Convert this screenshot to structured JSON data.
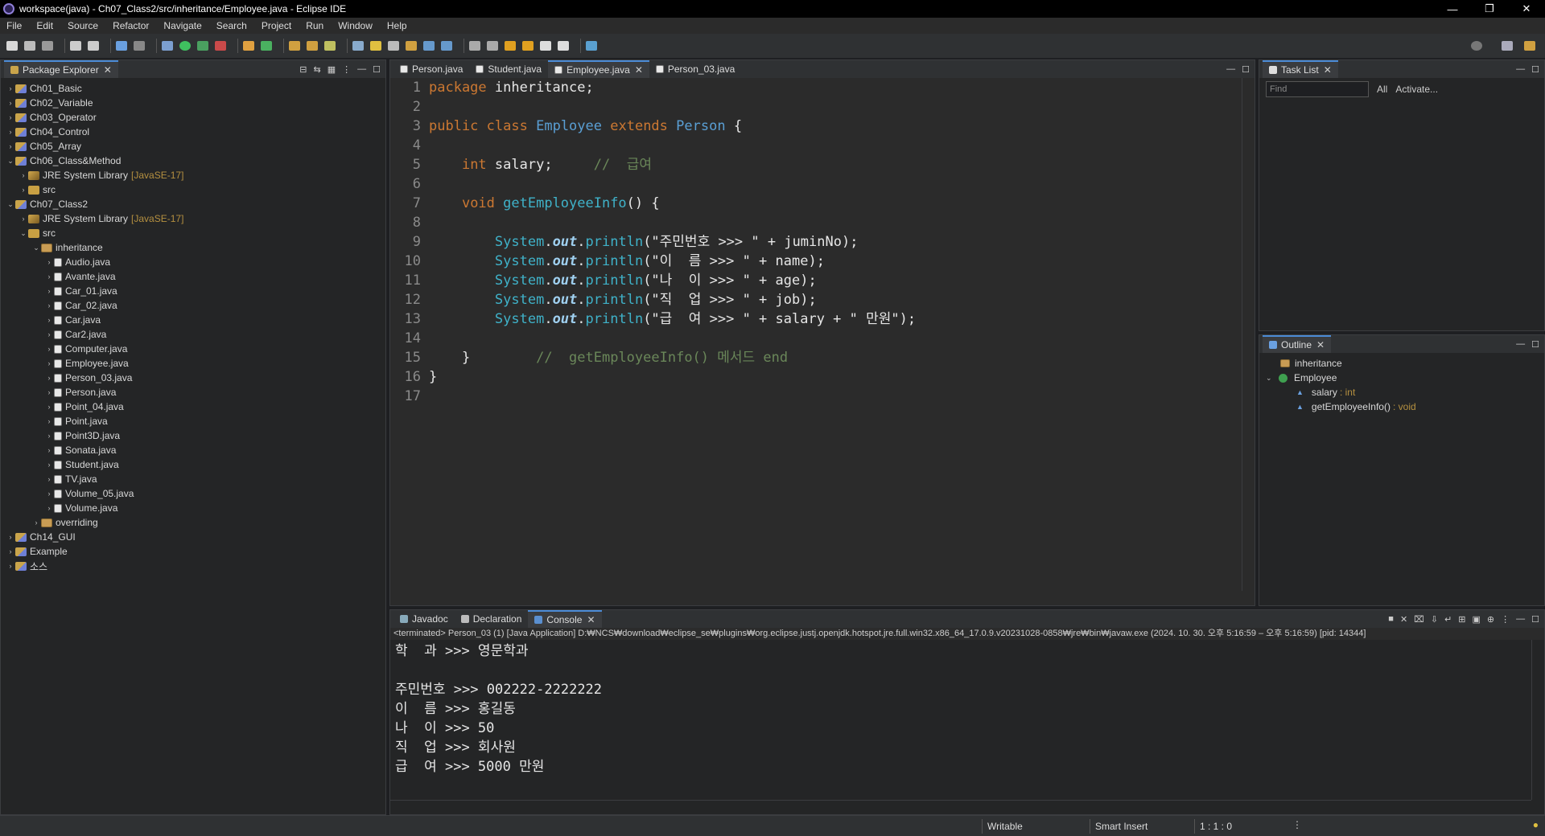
{
  "window": {
    "title": "workspace(java) - Ch07_Class2/src/inheritance/Employee.java - Eclipse IDE"
  },
  "menu": [
    "File",
    "Edit",
    "Source",
    "Refactor",
    "Navigate",
    "Search",
    "Project",
    "Run",
    "Window",
    "Help"
  ],
  "package_explorer": {
    "tab_label": "Package Explorer",
    "items": [
      {
        "label": "Ch01_Basic",
        "icon": "project",
        "arrow": "›",
        "indent": 0
      },
      {
        "label": "Ch02_Variable",
        "icon": "project",
        "arrow": "›",
        "indent": 0
      },
      {
        "label": "Ch03_Operator",
        "icon": "project",
        "arrow": "›",
        "indent": 0
      },
      {
        "label": "Ch04_Control",
        "icon": "project",
        "arrow": "›",
        "indent": 0
      },
      {
        "label": "Ch05_Array",
        "icon": "project",
        "arrow": "›",
        "indent": 0
      },
      {
        "label": "Ch06_Class&Method",
        "icon": "project",
        "arrow": "⌄",
        "indent": 0
      },
      {
        "label": "JRE System Library",
        "deco": "[JavaSE-17]",
        "icon": "lib",
        "arrow": "›",
        "indent": 1
      },
      {
        "label": "src",
        "icon": "src",
        "arrow": "›",
        "indent": 1
      },
      {
        "label": "Ch07_Class2",
        "icon": "project",
        "arrow": "⌄",
        "indent": 0
      },
      {
        "label": "JRE System Library",
        "deco": "[JavaSE-17]",
        "icon": "lib",
        "arrow": "›",
        "indent": 1
      },
      {
        "label": "src",
        "icon": "src",
        "arrow": "⌄",
        "indent": 1
      },
      {
        "label": "inheritance",
        "icon": "pkg",
        "arrow": "⌄",
        "indent": 2
      },
      {
        "label": "Audio.java",
        "icon": "java",
        "arrow": "›",
        "indent": 3
      },
      {
        "label": "Avante.java",
        "icon": "java",
        "arrow": "›",
        "indent": 3
      },
      {
        "label": "Car_01.java",
        "icon": "java",
        "arrow": "›",
        "indent": 3
      },
      {
        "label": "Car_02.java",
        "icon": "java",
        "arrow": "›",
        "indent": 3
      },
      {
        "label": "Car.java",
        "icon": "java",
        "arrow": "›",
        "indent": 3
      },
      {
        "label": "Car2.java",
        "icon": "java",
        "arrow": "›",
        "indent": 3
      },
      {
        "label": "Computer.java",
        "icon": "java",
        "arrow": "›",
        "indent": 3
      },
      {
        "label": "Employee.java",
        "icon": "java",
        "arrow": "›",
        "indent": 3
      },
      {
        "label": "Person_03.java",
        "icon": "java",
        "arrow": "›",
        "indent": 3
      },
      {
        "label": "Person.java",
        "icon": "java",
        "arrow": "›",
        "indent": 3
      },
      {
        "label": "Point_04.java",
        "icon": "java",
        "arrow": "›",
        "indent": 3
      },
      {
        "label": "Point.java",
        "icon": "java",
        "arrow": "›",
        "indent": 3
      },
      {
        "label": "Point3D.java",
        "icon": "java",
        "arrow": "›",
        "indent": 3
      },
      {
        "label": "Sonata.java",
        "icon": "java",
        "arrow": "›",
        "indent": 3
      },
      {
        "label": "Student.java",
        "icon": "java",
        "arrow": "›",
        "indent": 3
      },
      {
        "label": "TV.java",
        "icon": "java",
        "arrow": "›",
        "indent": 3
      },
      {
        "label": "Volume_05.java",
        "icon": "java",
        "arrow": "›",
        "indent": 3
      },
      {
        "label": "Volume.java",
        "icon": "java",
        "arrow": "›",
        "indent": 3
      },
      {
        "label": "overriding",
        "icon": "pkg",
        "arrow": "›",
        "indent": 2
      },
      {
        "label": "Ch14_GUI",
        "icon": "project",
        "arrow": "›",
        "indent": 0
      },
      {
        "label": "Example",
        "icon": "project",
        "arrow": "›",
        "indent": 0
      },
      {
        "label": "소스",
        "icon": "project",
        "arrow": "›",
        "indent": 0
      }
    ]
  },
  "editor": {
    "tabs": [
      {
        "label": "Person.java",
        "active": false
      },
      {
        "label": "Student.java",
        "active": false
      },
      {
        "label": "Employee.java",
        "active": true
      },
      {
        "label": "Person_03.java",
        "active": false
      }
    ],
    "line_numbers": [
      "1",
      "2",
      "3",
      "4",
      "5",
      "6",
      "7",
      "8",
      "9",
      "10",
      "11",
      "12",
      "13",
      "14",
      "15",
      "16",
      "17"
    ],
    "code": {
      "l1_kw": "package",
      "l1_rest": " inheritance;",
      "l3_kw1": "public",
      "l3_kw2": "class",
      "l3_name": "Employee",
      "l3_kw3": "extends",
      "l3_parent": "Person",
      "l3_brace": " {",
      "l5_type": "int",
      "l5_var": " salary;",
      "l5_comment": "//  급여",
      "l7_type": "void",
      "l7_name": " getEmployeeInfo",
      "l7_rest": "() {",
      "sys": "System",
      "dot": ".",
      "out": "out",
      "println": "println",
      "l9_str": "(\"주민번호 >>> \" + juminNo);",
      "l10_str": "(\"이  름 >>> \" + name);",
      "l11_str": "(\"나  이 >>> \" + age);",
      "l12_str": "(\"직  업 >>> \" + job);",
      "l13_str": "(\"급  여 >>> \" + salary + \" 만원\");",
      "l15_brace": "}",
      "l15_comment": "//  getEmployeeInfo() 메서드 end",
      "l16_brace": "}"
    }
  },
  "task_list": {
    "tab_label": "Task List",
    "find_placeholder": "Find",
    "all_label": "All",
    "activate_label": "Activate..."
  },
  "outline": {
    "tab_label": "Outline",
    "package": "inheritance",
    "class": "Employee",
    "members": [
      {
        "name": "salary",
        "type": ": int"
      },
      {
        "name": "getEmployeeInfo()",
        "type": ": void"
      }
    ]
  },
  "console": {
    "tabs": [
      {
        "label": "Javadoc",
        "active": false
      },
      {
        "label": "Declaration",
        "active": false
      },
      {
        "label": "Console",
        "active": true
      }
    ],
    "info": "<terminated> Person_03 (1) [Java Application] D:₩NCS₩download₩eclipse_se₩plugins₩org.eclipse.justj.openjdk.hotspot.jre.full.win32.x86_64_17.0.9.v20231028-0858₩jre₩bin₩javaw.exe  (2024. 10. 30. 오후 5:16:59 – 오후 5:16:59) [pid: 14344]",
    "lines": [
      "학  과 >>> 영문학과",
      "",
      "주민번호 >>> 002222-2222222",
      "이  름 >>> 홍길동",
      "나  이 >>> 50",
      "직  업 >>> 회사원",
      "급  여 >>> 5000 만원"
    ]
  },
  "status": {
    "writable": "Writable",
    "insert_mode": "Smart Insert",
    "position": "1 : 1 : 0"
  },
  "colors": {
    "keyword": "#cc7832",
    "type": "#5a9fd4",
    "comment": "#6a8759",
    "accent": "#4b8bd6"
  }
}
